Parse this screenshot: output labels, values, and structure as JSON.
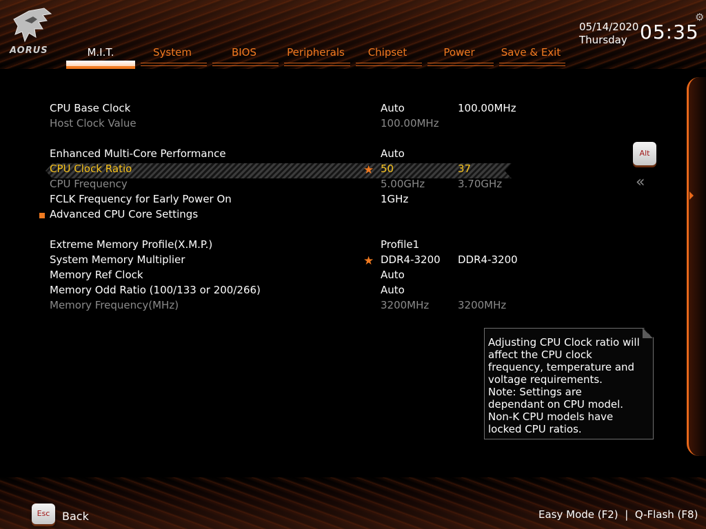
{
  "brand": {
    "logo_text": "AORUS"
  },
  "tabs": [
    {
      "label": "M.I.T."
    },
    {
      "label": "System"
    },
    {
      "label": "BIOS"
    },
    {
      "label": "Peripherals"
    },
    {
      "label": "Chipset"
    },
    {
      "label": "Power"
    },
    {
      "label": "Save & Exit"
    }
  ],
  "active_tab": "M.I.T.",
  "datetime": {
    "date": "05/14/2020",
    "day": "Thursday",
    "time": "05:35"
  },
  "settings": [
    {
      "name": "CPU Base Clock",
      "value1": "Auto",
      "value2": "100.00MHz"
    },
    {
      "name": "Host Clock Value",
      "value1": "100.00MHz",
      "value2": ""
    },
    {
      "name": "Enhanced Multi-Core Performance",
      "value1": "Auto",
      "value2": ""
    },
    {
      "name": "CPU Clock Ratio",
      "value1": "50",
      "value2": "37"
    },
    {
      "name": "CPU Frequency",
      "value1": "5.00GHz",
      "value2": "3.70GHz"
    },
    {
      "name": "FCLK Frequency for Early Power On",
      "value1": "1GHz",
      "value2": ""
    },
    {
      "name": "Advanced CPU Core Settings",
      "value1": "",
      "value2": ""
    },
    {
      "name": "Extreme Memory Profile(X.M.P.)",
      "value1": "Profile1",
      "value2": ""
    },
    {
      "name": "System Memory Multiplier",
      "value1": "DDR4-3200",
      "value2": "DDR4-3200"
    },
    {
      "name": "Memory Ref Clock",
      "value1": "Auto",
      "value2": ""
    },
    {
      "name": "Memory Odd Ratio (100/133 or 200/266)",
      "value1": "Auto",
      "value2": ""
    },
    {
      "name": "Memory Frequency(MHz)",
      "value1": "3200MHz",
      "value2": "3200MHz"
    }
  ],
  "side": {
    "alt_label": "Alt",
    "collapse_glyph": "«"
  },
  "help_text": "Adjusting CPU Clock ratio will\naffect the CPU clock\nfrequency, temperature and\nvoltage requirements.\nNote: Settings are\ndependant  on  CPU model.\nNon-K CPU models have\nlocked CPU ratios.",
  "footer": {
    "esc_label": "Esc",
    "back_label": "Back",
    "easy_mode": "Easy Mode (F2)",
    "separator": "|",
    "qflash": "Q-Flash (F8)"
  },
  "colors": {
    "accent": "#f07a20",
    "selected_text": "#f7c21c",
    "dim_text": "#8a8a8a"
  },
  "icons": [
    "aorus-eagle-logo-icon",
    "gear-icon",
    "star-icon",
    "square-bullet-icon",
    "double-chevron-left-icon",
    "panel-arrow-right-icon"
  ]
}
